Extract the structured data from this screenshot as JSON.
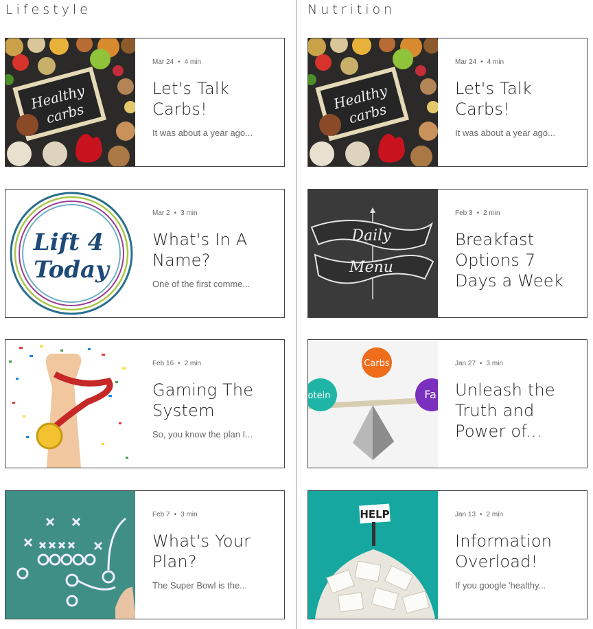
{
  "lifestyle": {
    "heading": "Lifestyle",
    "posts": [
      {
        "date": "Mar 24",
        "read": "4 min",
        "title": "Let's Talk Carbs!",
        "excerpt": "It was about a year ago..."
      },
      {
        "date": "Mar 2",
        "read": "3 min",
        "title": "What's In A Name?",
        "excerpt": "One of the first comme..."
      },
      {
        "date": "Feb 16",
        "read": "2 min",
        "title": "Gaming The System",
        "excerpt": "So, you know the plan I..."
      },
      {
        "date": "Feb 7",
        "read": "3 min",
        "title": "What's Your Plan?",
        "excerpt": "The Super Bowl is the..."
      }
    ]
  },
  "nutrition": {
    "heading": "Nutrition",
    "posts": [
      {
        "date": "Mar 24",
        "read": "4 min",
        "title": "Let's Talk Carbs!",
        "excerpt": "It was about a year ago..."
      },
      {
        "date": "Feb 3",
        "read": "2 min",
        "title": "Breakfast Options 7 Days a Week",
        "excerpt": ""
      },
      {
        "date": "Jan 27",
        "read": "3 min",
        "title": "Unleash the Truth and Power of...",
        "excerpt": ""
      },
      {
        "date": "Jan 13",
        "read": "2 min",
        "title": "Information Overload!",
        "excerpt": "If you google 'healthy..."
      }
    ]
  },
  "image_text": {
    "healthy": "Healthy",
    "carbs": "carbs",
    "lift4": "Lift 4",
    "today": "Today",
    "daily": "Daily",
    "menu": "Menu",
    "carbs_ball": "Carbs",
    "protein_ball": "otein",
    "fat_ball": "Fa",
    "help": "HELP"
  },
  "colors": {
    "border": "#444444",
    "divider": "#9a9a9a",
    "text": "#222222",
    "muted": "#666666"
  }
}
